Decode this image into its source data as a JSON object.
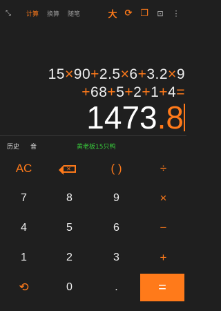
{
  "header": {
    "collapse_icon": "collapse-icon",
    "tabs": [
      "计算",
      "换算",
      "随笔"
    ],
    "tools": {
      "theme_label": "大",
      "timer_icon": "timer-icon",
      "copy_icon": "copy-icon",
      "scan_icon": "scan-icon",
      "more_icon": "more-icon"
    }
  },
  "display": {
    "expression_line1": "15×90+2.5×6+3.2×9",
    "expression_line2": "+68+5+2+1+4=",
    "result_integer": "1473",
    "result_fraction": ".8"
  },
  "history_bar": {
    "history_label": "历史",
    "sound_label": "音",
    "note": "黄老板15只鸭"
  },
  "keypad": {
    "ac": "AC",
    "parens": "( )",
    "divide": "÷",
    "multiply": "×",
    "minus": "−",
    "plus": "+",
    "equals": "=",
    "dot": ".",
    "digits": [
      "0",
      "1",
      "2",
      "3",
      "4",
      "5",
      "6",
      "7",
      "8",
      "9"
    ],
    "backspace_icon": "backspace-icon",
    "rotate_icon": "rotate-icon"
  },
  "colors": {
    "accent": "#ff7a1a",
    "background": "#1f1f1f",
    "note": "#37c23a"
  }
}
